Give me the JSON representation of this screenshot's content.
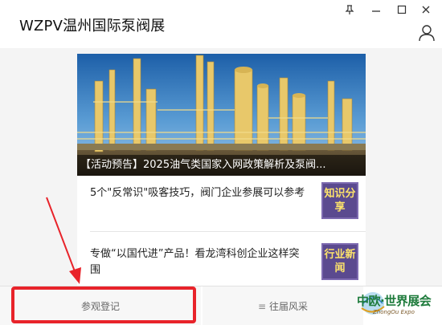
{
  "window": {
    "title": "WZPV温州国际泵阀展",
    "controls": [
      "pin-icon",
      "minimize-icon",
      "maximize-icon",
      "close-icon"
    ],
    "user_icon": "user-icon"
  },
  "hero": {
    "caption": "【活动预告】2025油气类国家入网政策解析及泵阀..."
  },
  "articles": [
    {
      "title": "5个\"反常识\"吸客技巧，阀门企业参展可以参考",
      "thumb_label": "知识分享"
    },
    {
      "title": "专做“以国代进”产品！看龙湾科创企业这样突围",
      "thumb_label": "行业新闻"
    }
  ],
  "bottom": {
    "register_label": "参观登记",
    "past_label": "往届风采",
    "past_icon": "menu-icon",
    "logo_text": "中欧·世界展会",
    "logo_sub": "ZhongOu Expo"
  },
  "annotation": {
    "box_color": "#e8232a"
  }
}
